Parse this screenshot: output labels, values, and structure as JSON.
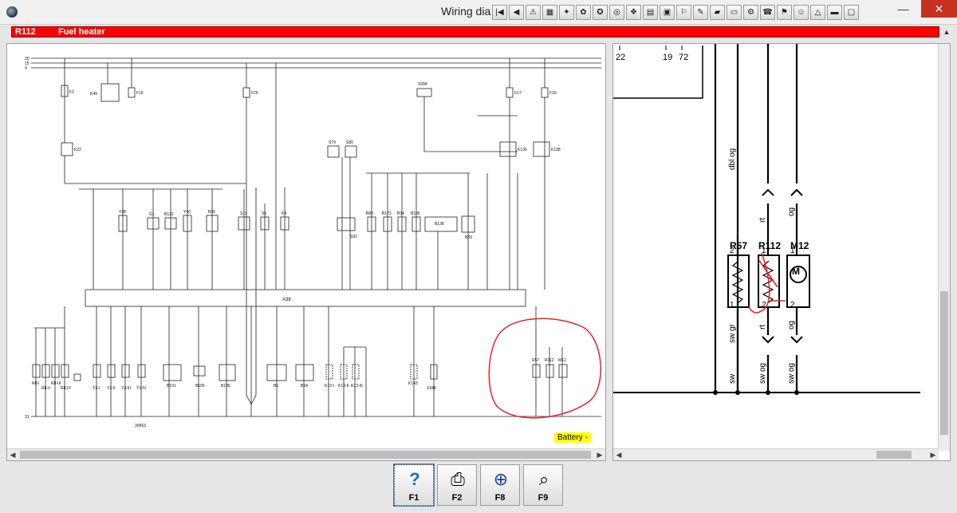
{
  "window": {
    "title": "Wiring dia",
    "minimize": "—",
    "close": "✕"
  },
  "component": {
    "code": "R112",
    "name": "Fuel heater"
  },
  "left_diagram": {
    "drawing_number": "30963",
    "bus_labels": [
      "30",
      "15",
      "X",
      "31"
    ],
    "battery_label": "Battery -",
    "top_labels": [
      "F1",
      "K49",
      "F16",
      "F26",
      "X284",
      "F17",
      "F18",
      "K22",
      "K136",
      "K138",
      "S79",
      "S80"
    ],
    "mid_labels": [
      "Y38",
      "G1",
      "B132",
      "Y40",
      "B36",
      "S13",
      "X1",
      "K4",
      "S92",
      "B82",
      "B173",
      "B34",
      "B106",
      "B138",
      "B33"
    ],
    "controller": "A38",
    "bottom_labels": [
      "R8-I",
      "R8-II",
      "R8-III",
      "R8-IV",
      "Y3-I",
      "Y3-II",
      "Y3-III",
      "Y3-IV",
      "B101",
      "B105",
      "B186",
      "B6",
      "B54",
      "K13-I",
      "K13-II",
      "K13-III",
      "K143",
      "X348",
      "R57",
      "R112",
      "M12"
    ]
  },
  "right_diagram": {
    "pins": [
      "22",
      "19",
      "72"
    ],
    "wire_colors": {
      "vertical_left": "dbl og",
      "r112_top": "rt",
      "m12_top": "og",
      "r57_bottom": "sw gr",
      "r112_bottom": "rt",
      "m12_bottom": "og",
      "ground_1": "sw",
      "ground_2": "sw og",
      "ground_3": "sw og"
    },
    "components": [
      {
        "label": "R57",
        "pin_top": "2",
        "pin_bottom": "1"
      },
      {
        "label": "R112",
        "pin_top": "1",
        "pin_bottom": "2"
      },
      {
        "label": "M12",
        "pin_top": "1",
        "pin_bottom": "2"
      }
    ]
  },
  "function_keys": [
    {
      "key": "F1",
      "icon": "help-icon"
    },
    {
      "key": "F2",
      "icon": "printer-icon"
    },
    {
      "key": "F8",
      "icon": "component-lookup-icon"
    },
    {
      "key": "F9",
      "icon": "zoom-icon"
    }
  ],
  "colors": {
    "highlight_bar": "#ff0000",
    "annotation": "#e8202a",
    "battery_tag": "#ffff00"
  }
}
